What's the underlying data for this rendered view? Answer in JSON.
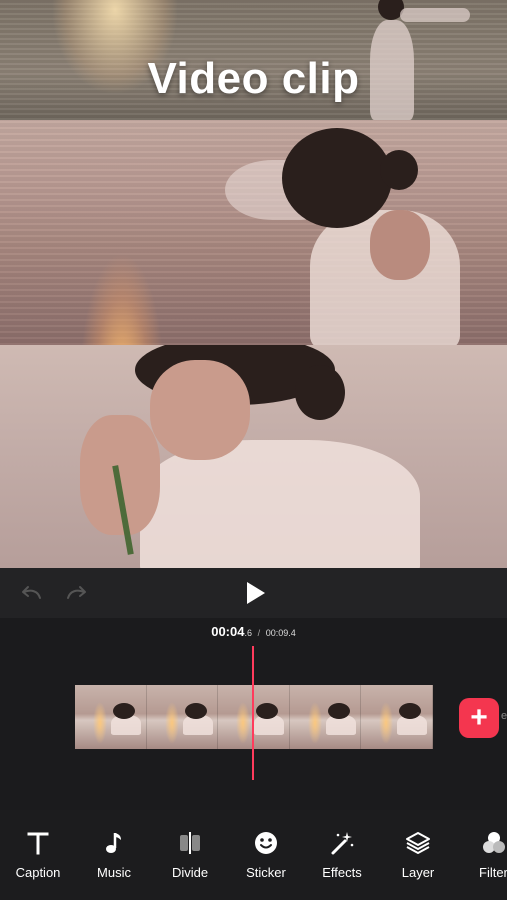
{
  "overlay": {
    "title": "Video clip"
  },
  "player": {
    "timecode_current": "00:04",
    "timecode_current_frac": ".6",
    "timecode_sep": "/",
    "timecode_total": "00:09.4"
  },
  "timeline": {
    "clip_count": 5,
    "edge_label": "e"
  },
  "toolbar": {
    "tools": [
      {
        "label": "Caption",
        "icon": "text-icon"
      },
      {
        "label": "Music",
        "icon": "music-note-icon"
      },
      {
        "label": "Divide",
        "icon": "divide-icon"
      },
      {
        "label": "Sticker",
        "icon": "smiley-icon"
      },
      {
        "label": "Effects",
        "icon": "magic-wand-icon"
      },
      {
        "label": "Layer",
        "icon": "layers-icon"
      },
      {
        "label": "Filter",
        "icon": "filter-icon"
      }
    ]
  },
  "colors": {
    "accent": "#f4364f",
    "playhead": "#ff3b5c",
    "background": "#1c1c1e"
  }
}
